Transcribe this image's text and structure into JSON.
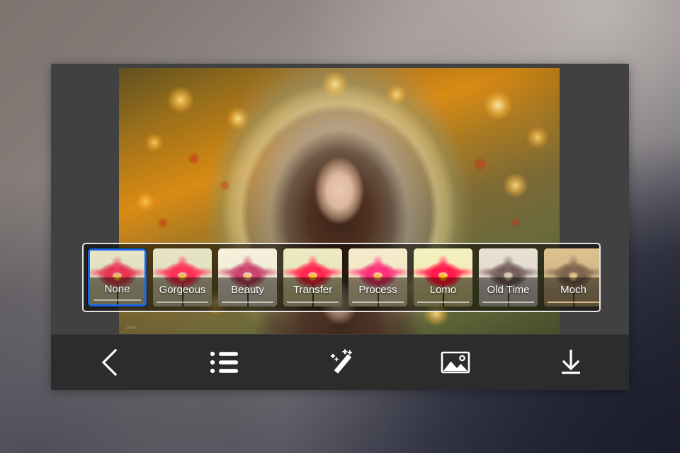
{
  "app": {
    "screen_name": "photo-filter-editor",
    "background_colors": {
      "top_left": "#7d7470",
      "top_right": "#b0a9a5",
      "bottom_left": "#434450",
      "bottom_right": "#1e2130"
    },
    "window_background": "#414142",
    "toolbar_background": "#2c2c2c",
    "accent_selection": "#1769e8"
  },
  "photo": {
    "name": "portrait-floral-arch-candlelight",
    "watermark": "DMP"
  },
  "filter_strip": {
    "name": "filter-carousel",
    "selected_index": 0,
    "border_color": "#ffffff",
    "filters": [
      {
        "label": "None",
        "class": "f-none",
        "selected": true
      },
      {
        "label": "Gorgeous",
        "class": "f-gorgeous",
        "selected": false
      },
      {
        "label": "Beauty",
        "class": "f-beauty",
        "selected": false
      },
      {
        "label": "Transfer",
        "class": "f-transfer",
        "selected": false
      },
      {
        "label": "Process",
        "class": "f-process",
        "selected": false
      },
      {
        "label": "Lomo",
        "class": "f-lomo",
        "selected": false
      },
      {
        "label": "Old Time",
        "class": "f-oldtime",
        "selected": false
      },
      {
        "label": "Moch",
        "class": "f-mocha",
        "selected": false
      }
    ]
  },
  "toolbar": {
    "buttons": [
      {
        "name": "back-button",
        "icon": "chevron-left-icon"
      },
      {
        "name": "list-button",
        "icon": "bullet-list-icon"
      },
      {
        "name": "effects-button",
        "icon": "magic-wand-icon"
      },
      {
        "name": "gallery-button",
        "icon": "image-icon"
      },
      {
        "name": "save-button",
        "icon": "download-icon"
      }
    ]
  }
}
